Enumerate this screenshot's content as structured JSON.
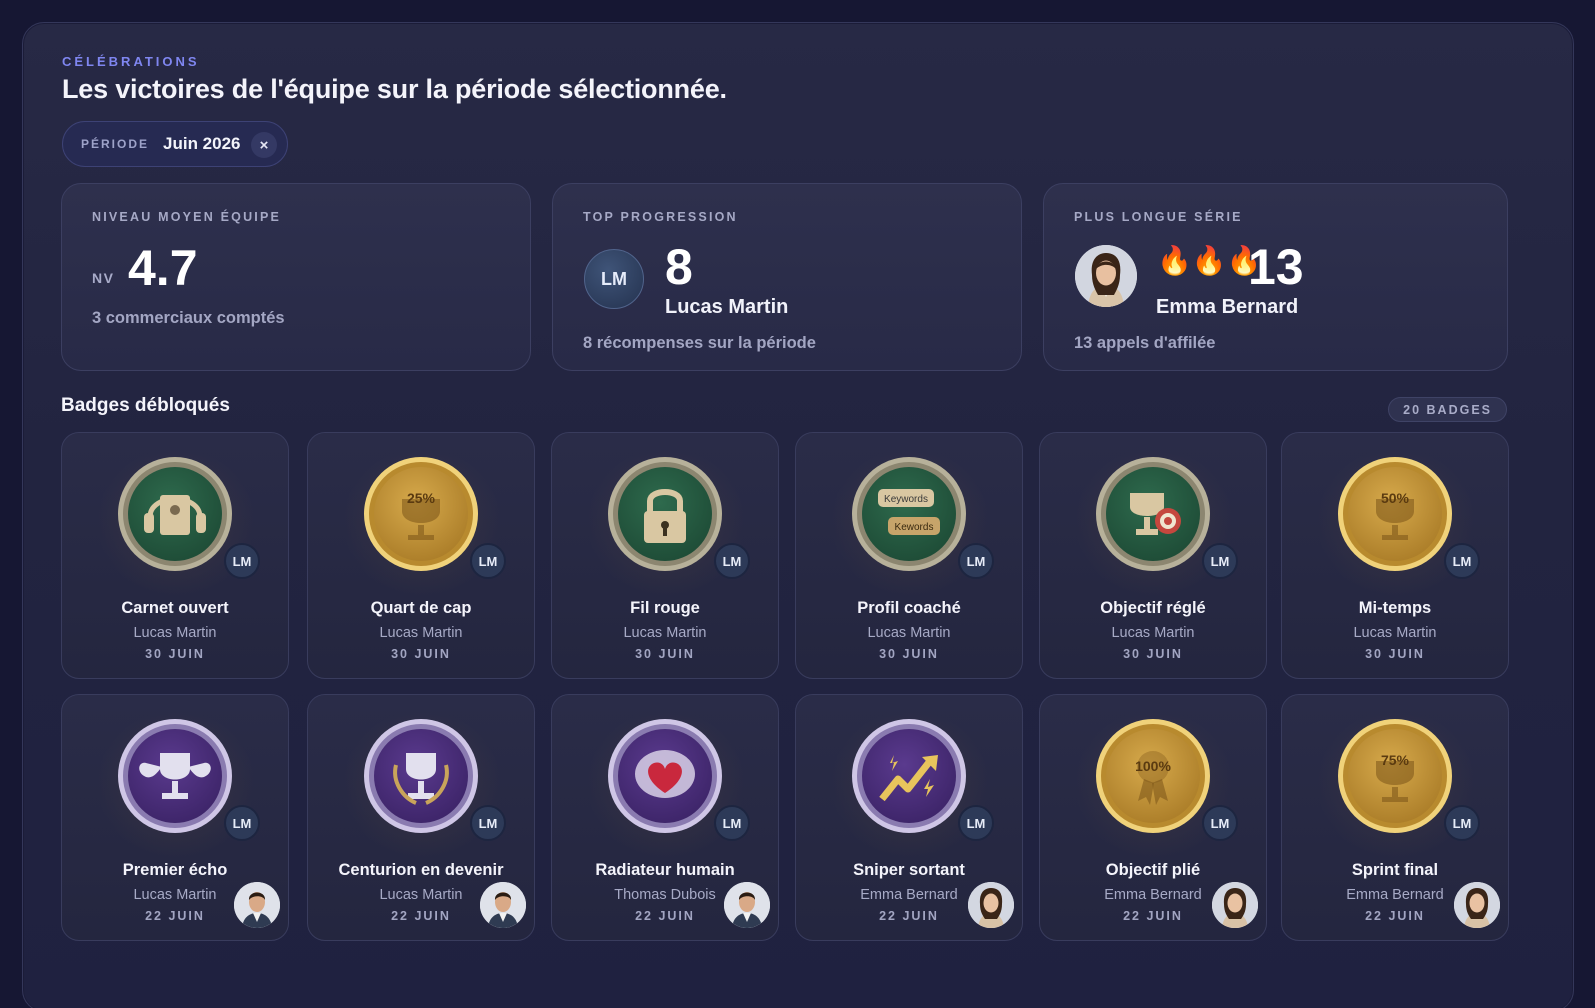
{
  "header": {
    "eyebrow": "CÉLÉBRATIONS",
    "title": "Les victoires de l'équipe sur la période sélectionnée.",
    "period_label": "PÉRIODE",
    "period_value": "Juin 2026",
    "period_clear": "×"
  },
  "stats": {
    "team_level": {
      "label": "NIVEAU MOYEN ÉQUIPE",
      "prefix": "NV",
      "value": "4.7",
      "sub": "3 commerciaux comptés"
    },
    "top_progress": {
      "label": "TOP PROGRESSION",
      "avatar": "LM",
      "value": "8",
      "name": "Lucas Martin",
      "sub": "8 récompenses sur la période"
    },
    "longest_streak": {
      "label": "PLUS LONGUE SÉRIE",
      "flames": "🔥🔥🔥",
      "value": "13",
      "name": "Emma Bernard",
      "sub": "13 appels d'affilée"
    }
  },
  "badges_section": {
    "title": "Badges débloqués",
    "count": "20 BADGES"
  },
  "badges": [
    {
      "name": "Carnet ouvert",
      "owner": "Lucas Martin",
      "date": "30 JUIN",
      "chip": "LM",
      "icon": "headset-notebook-icon"
    },
    {
      "name": "Quart de cap",
      "owner": "Lucas Martin",
      "date": "30 JUIN",
      "chip": "LM",
      "icon": "trophy-25-icon",
      "medal_text": "25%"
    },
    {
      "name": "Fil rouge",
      "owner": "Lucas Martin",
      "date": "30 JUIN",
      "chip": "LM",
      "icon": "padlock-icon"
    },
    {
      "name": "Profil coaché",
      "owner": "Lucas Martin",
      "date": "30 JUIN",
      "chip": "LM",
      "icon": "keywords-bubbles-icon",
      "medal_text": "Keywords",
      "medal_text2": "Kewords"
    },
    {
      "name": "Objectif réglé",
      "owner": "Lucas Martin",
      "date": "30 JUIN",
      "chip": "LM",
      "icon": "trophy-target-icon"
    },
    {
      "name": "Mi-temps",
      "owner": "Lucas Martin",
      "date": "30 JUIN",
      "chip": "LM",
      "icon": "trophy-50-icon",
      "medal_text": "50%"
    },
    {
      "name": "Premier écho",
      "owner": "Lucas Martin",
      "date": "22 JUIN",
      "chip": "LM",
      "icon": "winged-cup-icon"
    },
    {
      "name": "Centurion en devenir",
      "owner": "Lucas Martin",
      "date": "22 JUIN",
      "chip": "LM",
      "icon": "laurel-cup-icon"
    },
    {
      "name": "Radiateur humain",
      "owner": "Thomas Dubois",
      "date": "22 JUIN",
      "chip": "LM",
      "icon": "heart-gem-icon"
    },
    {
      "name": "Sniper sortant",
      "owner": "Emma Bernard",
      "date": "22 JUIN",
      "chip": "LM",
      "icon": "lightning-arrow-icon"
    },
    {
      "name": "Objectif plié",
      "owner": "Emma Bernard",
      "date": "22 JUIN",
      "chip": "LM",
      "icon": "ribbon-100-icon",
      "medal_text": "100%"
    },
    {
      "name": "Sprint final",
      "owner": "Emma Bernard",
      "date": "22 JUIN",
      "chip": "LM",
      "icon": "trophy-75-icon",
      "medal_text": "75%"
    }
  ],
  "colors": {
    "background": "#161733",
    "accent": "#7f86f0",
    "medal_green": "#2f6a4f",
    "medal_gold": "#c89a3b",
    "medal_purple": "#5a3a8a"
  }
}
